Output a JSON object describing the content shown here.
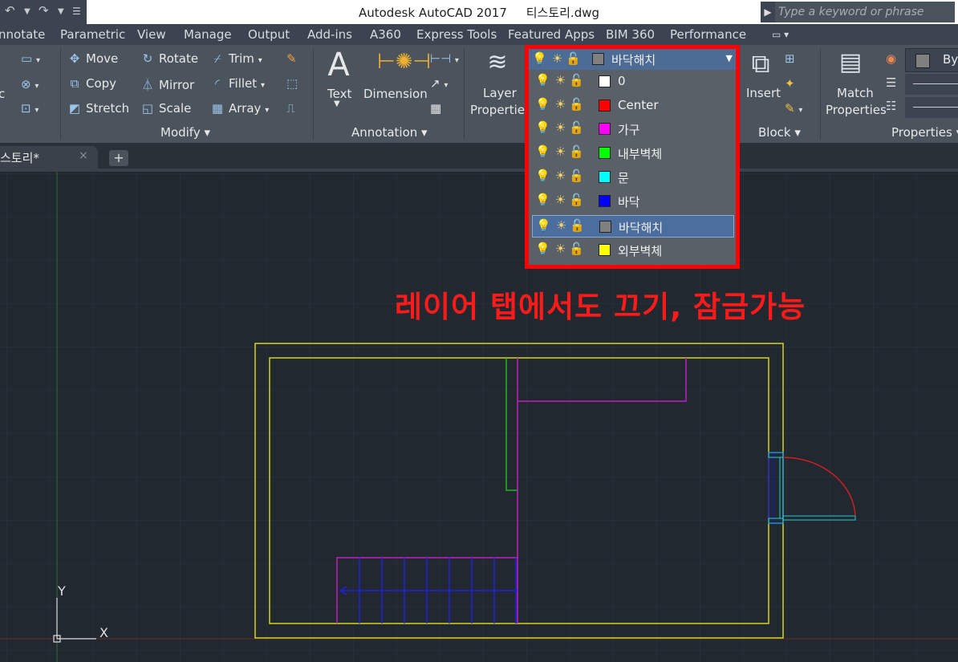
{
  "window": {
    "title": "Autodesk AutoCAD 2017",
    "filename": "티스토리.dwg",
    "search_placeholder": "Type a keyword or phrase"
  },
  "ribbon_tabs": [
    "nnotate",
    "Parametric",
    "View",
    "Manage",
    "Output",
    "Add-ins",
    "A360",
    "Express Tools",
    "Featured Apps",
    "BIM 360",
    "Performance"
  ],
  "modify": {
    "left_stub": "c",
    "move": "Move",
    "copy": "Copy",
    "stretch": "Stretch",
    "rotate": "Rotate",
    "mirror": "Mirror",
    "scale": "Scale",
    "trim": "Trim",
    "fillet": "Fillet",
    "array": "Array",
    "title": "Modify"
  },
  "annotation_panel": {
    "text": "Text",
    "dimension": "Dimension",
    "title": "Annotation"
  },
  "layers_panel": {
    "layer_properties_line1": "Layer",
    "layer_properties_line2": "Properties"
  },
  "block_panel": {
    "insert": "Insert",
    "title": "Block"
  },
  "properties_panel": {
    "match_line1": "Match",
    "match_line2": "Properties",
    "bylayer": "ByL",
    "title": "Properties"
  },
  "file_tab": {
    "label": "스토리*",
    "close": "×",
    "new": "+"
  },
  "layer_dropdown": {
    "current": {
      "name": "바닥해치",
      "color": "#808080"
    },
    "items": [
      {
        "name": "0",
        "color": "#ffffff"
      },
      {
        "name": "Center",
        "color": "#ff0000"
      },
      {
        "name": "가구",
        "color": "#ff00ff"
      },
      {
        "name": "내부벽체",
        "color": "#00ff00"
      },
      {
        "name": "문",
        "color": "#00ffff"
      },
      {
        "name": "바닥",
        "color": "#0000ff"
      },
      {
        "name": "바닥해치",
        "color": "#808080",
        "selected": true
      },
      {
        "name": "외부벽체",
        "color": "#ffff00"
      }
    ]
  },
  "annotation_text": "레이어 탭에서도 끄기, 잠금가능",
  "ucs": {
    "x": "X",
    "y": "Y"
  },
  "colors": {
    "frame": "#ff0000",
    "canvas": "#212830",
    "ribbon": "#4b535d"
  }
}
